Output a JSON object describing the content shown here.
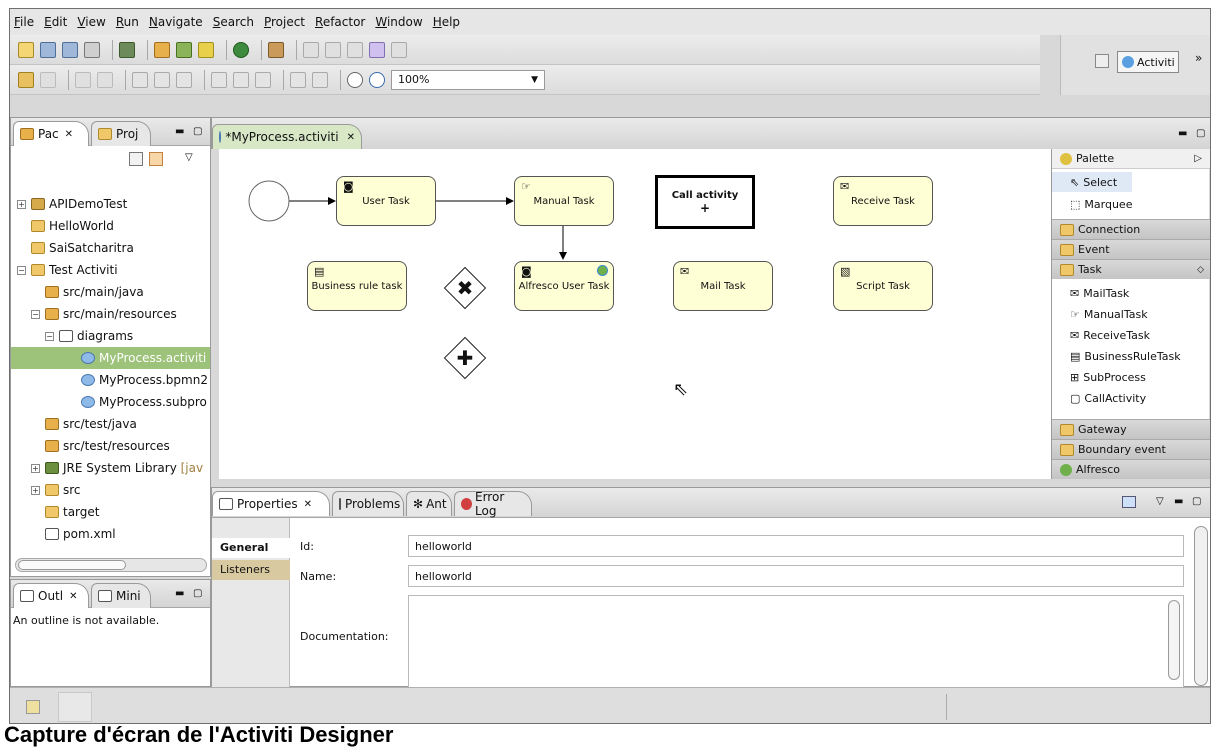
{
  "menu": [
    "File",
    "Edit",
    "View",
    "Run",
    "Navigate",
    "Search",
    "Project",
    "Refactor",
    "Window",
    "Help"
  ],
  "toolbar": {
    "zoom_value": "100%"
  },
  "perspective": {
    "label": "Activiti"
  },
  "explorer": {
    "tab_package": "Pac",
    "tab_project": "Proj",
    "items": [
      {
        "label": "APIDemoTest",
        "suffix": ""
      },
      {
        "label": "HelloWorld",
        "suffix": ""
      },
      {
        "label": "SaiSatcharitra",
        "suffix": ""
      },
      {
        "label": "Test Activiti",
        "suffix": ""
      },
      {
        "label": "src/main/java",
        "suffix": ""
      },
      {
        "label": "src/main/resources",
        "suffix": ""
      },
      {
        "label": "diagrams",
        "suffix": ""
      },
      {
        "label": "MyProcess.activiti",
        "suffix": ""
      },
      {
        "label": "MyProcess.bpmn2",
        "suffix": ""
      },
      {
        "label": "MyProcess.subpro",
        "suffix": ""
      },
      {
        "label": "src/test/java",
        "suffix": ""
      },
      {
        "label": "src/test/resources",
        "suffix": ""
      },
      {
        "label": "JRE System Library",
        "suffix": "[jav"
      },
      {
        "label": "src",
        "suffix": ""
      },
      {
        "label": "target",
        "suffix": ""
      },
      {
        "label": "pom.xml",
        "suffix": ""
      }
    ]
  },
  "outline": {
    "tab_outline": "Outl",
    "tab_mini": "Mini",
    "message": "An outline is not available."
  },
  "editor": {
    "tab_title": "*MyProcess.activiti"
  },
  "diagram": {
    "user_task": "User Task",
    "manual_task": "Manual Task",
    "call_activity": "Call activity",
    "call_activity_marker": "+",
    "receive_task": "Receive Task",
    "business_rule_task": "Business rule task",
    "alfresco_user_task": "Alfresco User Task",
    "mail_task": "Mail Task",
    "script_task": "Script Task"
  },
  "palette": {
    "title": "Palette",
    "tools": [
      "Select",
      "Marquee"
    ],
    "drawers": [
      "Connection",
      "Event",
      "Task"
    ],
    "task_items": [
      "MailTask",
      "ManualTask",
      "ReceiveTask",
      "BusinessRuleTask",
      "SubProcess",
      "CallActivity"
    ],
    "drawers_after": [
      "Gateway",
      "Boundary event",
      "Alfresco"
    ]
  },
  "properties_panel": {
    "tabs": [
      "Properties",
      "Problems",
      "Ant",
      "Error Log"
    ],
    "side_tabs": [
      "General",
      "Listeners"
    ],
    "labels": {
      "id": "Id:",
      "name": "Name:",
      "documentation": "Documentation:"
    },
    "values": {
      "id": "helloworld",
      "name": "helloworld",
      "documentation": ""
    }
  },
  "caption": "Capture d'écran de l'Activiti Designer"
}
